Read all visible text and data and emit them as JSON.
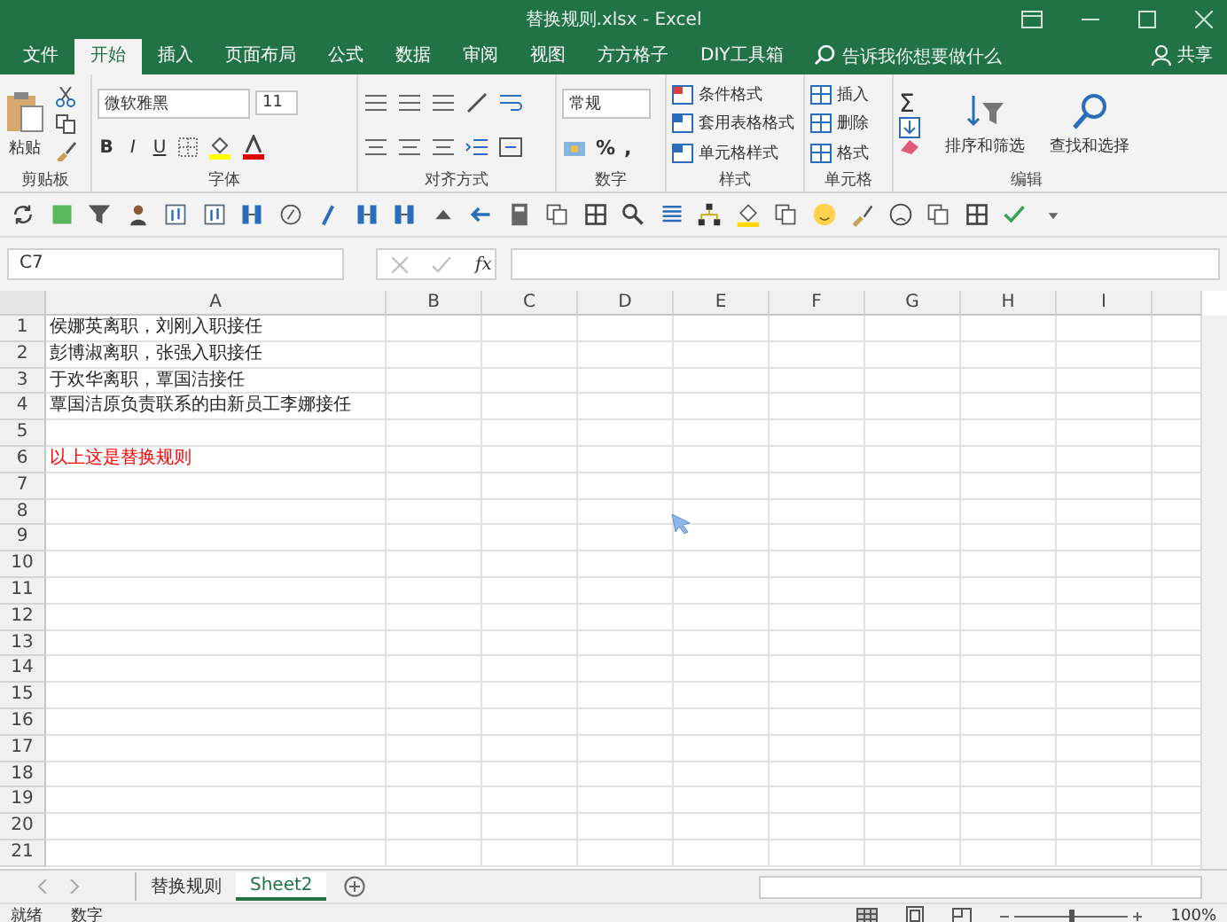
{
  "window": {
    "title": "替换规则.xlsx  -  Excel"
  },
  "ribbon_tabs": [
    {
      "label": "文件",
      "selected": false
    },
    {
      "label": "开始",
      "selected": true
    },
    {
      "label": "插入",
      "selected": false
    },
    {
      "label": "页面布局",
      "selected": false
    },
    {
      "label": "公式",
      "selected": false
    },
    {
      "label": "数据",
      "selected": false
    },
    {
      "label": "审阅",
      "selected": false
    },
    {
      "label": "视图",
      "selected": false
    },
    {
      "label": "方方格子",
      "selected": false
    },
    {
      "label": "DIY工具箱",
      "selected": false
    }
  ],
  "tell_me": {
    "placeholder": "告诉我你想要做什么"
  },
  "share": "共享",
  "ribbon": {
    "clipboard": {
      "paste": "粘贴",
      "label": "剪贴板"
    },
    "font": {
      "family": "微软雅黑",
      "size": "11",
      "bold": "B",
      "italic": "I",
      "underline": "U",
      "label": "字体"
    },
    "alignment": {
      "label": "对齐方式"
    },
    "number": {
      "format": "常规",
      "percent": "%",
      "comma": ",",
      "label": "数字"
    },
    "styles": {
      "items": [
        "条件格式",
        "套用表格格式",
        "单元格样式"
      ],
      "label": "样式"
    },
    "cells": {
      "items": [
        "插入",
        "删除",
        "格式"
      ],
      "label": "单元格"
    },
    "editing": {
      "sum": "Σ",
      "sort": "排序和筛选",
      "find": "查找和选择",
      "label": "编辑"
    }
  },
  "formula_bar": {
    "name_box": "C7",
    "fx": "fx"
  },
  "sheet": {
    "columns": [
      "A",
      "B",
      "C",
      "D",
      "E",
      "F",
      "G",
      "H",
      "I"
    ],
    "rows": [
      {
        "number": "1",
        "cell_a": "侯娜英离职，刘刚入职接任",
        "color": "#262626"
      },
      {
        "number": "2",
        "cell_a": "彭博淑离职，张强入职接任",
        "color": "#262626"
      },
      {
        "number": "3",
        "cell_a": "于欢华离职，覃国洁接任",
        "color": "#262626"
      },
      {
        "number": "4",
        "cell_a": "覃国洁原负责联系的由新员工李娜接任",
        "color": "#262626"
      },
      {
        "number": "5"
      },
      {
        "number": "6",
        "cell_a": "以上这是替换规则",
        "color": "#ff0000"
      },
      {
        "number": "7"
      },
      {
        "number": "8"
      },
      {
        "number": "9"
      },
      {
        "number": "10"
      },
      {
        "number": "11"
      },
      {
        "number": "12"
      },
      {
        "number": "13"
      },
      {
        "number": "14"
      },
      {
        "number": "15"
      },
      {
        "number": "16"
      },
      {
        "number": "17"
      },
      {
        "number": "18"
      },
      {
        "number": "19"
      },
      {
        "number": "20"
      },
      {
        "number": "21"
      }
    ]
  },
  "sheet_tabs": [
    {
      "label": "替换规则",
      "selected": false
    },
    {
      "label": "Sheet2",
      "selected": true
    }
  ],
  "status_bar": {
    "mode": "就绪",
    "indicator": "数字",
    "zoom": "100%"
  }
}
